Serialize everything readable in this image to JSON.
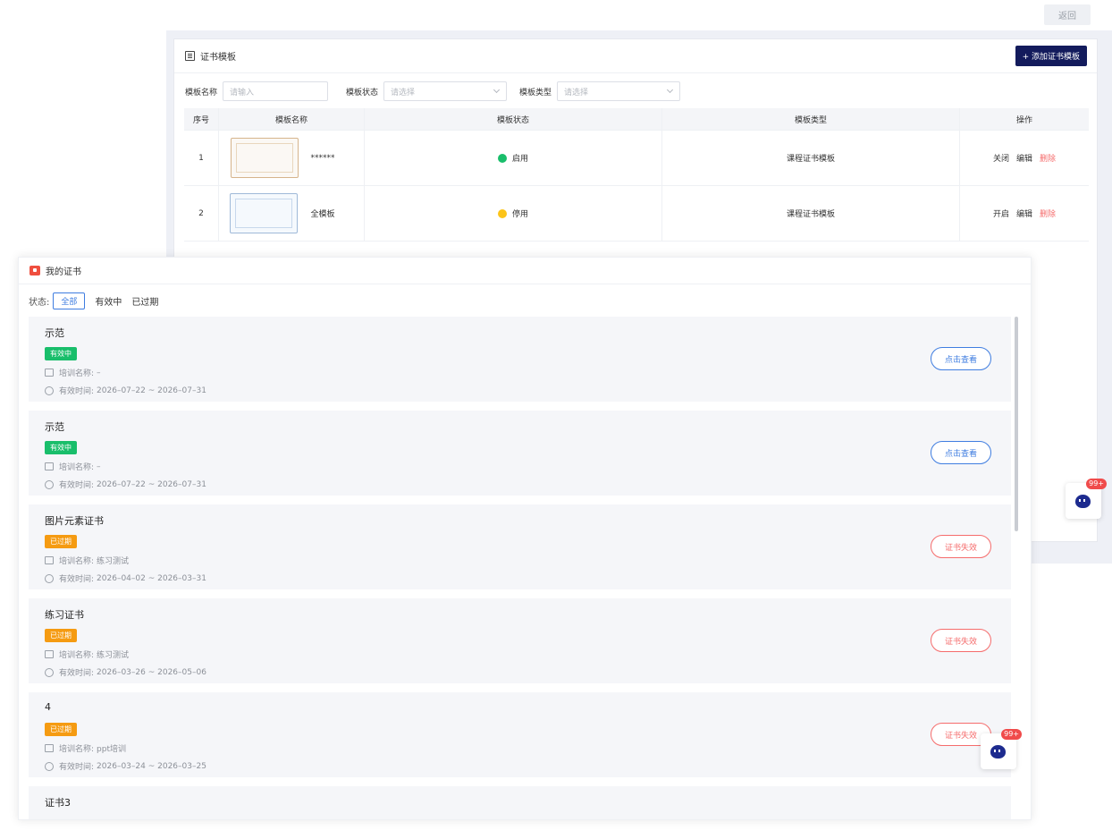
{
  "top": {
    "back_label": "返回"
  },
  "admin": {
    "title": "证书模板",
    "add_button": "+ 添加证书模板",
    "filters": [
      {
        "label": "模板名称",
        "placeholder": "请输入"
      },
      {
        "label": "模板状态",
        "placeholder": "请选择"
      },
      {
        "label": "模板类型",
        "placeholder": "请选择"
      }
    ],
    "columns": [
      "序号",
      "模板名称",
      "模板状态",
      "模板类型",
      "操作"
    ],
    "rows": [
      {
        "index": "1",
        "name": "******",
        "status": "启用",
        "status_color": "#19be6b",
        "type": "课程证书模板",
        "op_toggle": "关闭",
        "op_edit": "编辑",
        "op_delete": "删除"
      },
      {
        "index": "2",
        "name": "全模板",
        "status": "停用",
        "status_color": "#fcc419",
        "type": "课程证书模板",
        "op_toggle": "开启",
        "op_edit": "编辑",
        "op_delete": "删除"
      }
    ]
  },
  "chat": {
    "badge": "99+"
  },
  "my_certs": {
    "title": "我的证书",
    "status_label": "状态:",
    "tabs": [
      "全部",
      "有效中",
      "已过期"
    ],
    "training_label": "培训名称:",
    "valid_time_label": "有效时间:",
    "items": [
      {
        "name": "示范",
        "tag": "有效中",
        "training": "–",
        "period": "2026–07–22 ~ 2026–07–31",
        "action": "点击查看"
      },
      {
        "name": "示范",
        "tag": "有效中",
        "training": "–",
        "period": "2026–07–22 ~ 2026–07–31",
        "action": "点击查看"
      },
      {
        "name": "图片元素证书",
        "tag": "已过期",
        "training": "练习测试",
        "period": "2026–04–02 ~ 2026–03–31",
        "action": "证书失效"
      },
      {
        "name": "练习证书",
        "tag": "已过期",
        "training": "练习测试",
        "period": "2026–03–26 ~ 2026–05–06",
        "action": "证书失效"
      },
      {
        "name": "4",
        "tag": "已过期",
        "training": "ppt培训",
        "period": "2026–03–24 ~ 2026–03–25",
        "action": "证书失效"
      },
      {
        "name": "证书3"
      }
    ]
  }
}
